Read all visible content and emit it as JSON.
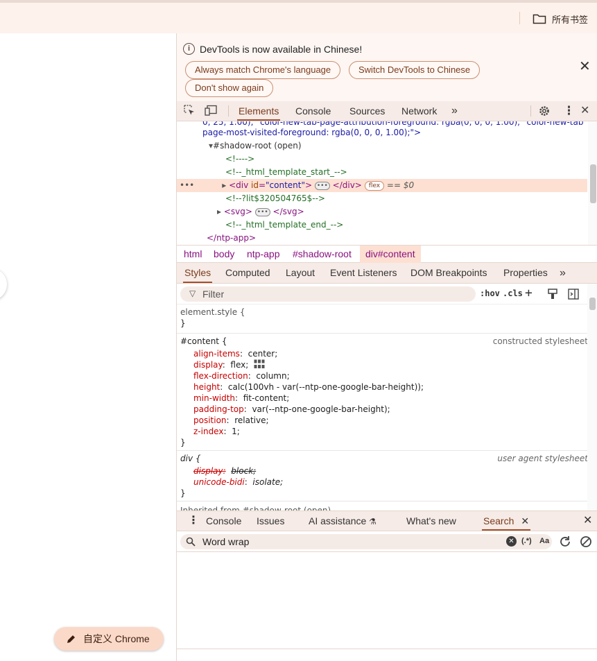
{
  "bookmarks_bar": {
    "all_bookmarks_label": "所有书签",
    "folder_icon": "folder-icon"
  },
  "page": {
    "customize_label": "自定义 Chrome",
    "pencil_icon": "pencil-icon"
  },
  "infobar": {
    "message": "DevTools is now available in Chinese!",
    "buttons": [
      "Always match Chrome's language",
      "Switch DevTools to Chinese",
      "Don't show again"
    ]
  },
  "toolbar": {
    "tabs": [
      "Elements",
      "Console",
      "Sources",
      "Network"
    ],
    "active_tab": "Elements",
    "more": "»"
  },
  "elements_tree": {
    "line0": "0, 25, 1.00);\" color-new-tab-page-attribution-foreground: rgba(0, 0, 0, 1.00);\" color-new-tab",
    "line1_a": "page-most-visited-foreground",
    "line1_b": ": rgba(0, 0, 0, 1.00);\">",
    "shadow_root": "#shadow-root (open)",
    "c1": "<!---->",
    "c2": "<!--_html_template_start_-->",
    "div_open": "<div ",
    "div_attr": "id",
    "div_attr_val": "\"content\"",
    "div_close": "</div>",
    "flex_badge": "flex",
    "eq": "== $0",
    "c3": "<!--?lit$320504765$-->",
    "svg_open": "<svg>",
    "svg_close": "</svg>",
    "c4": "<!--_html_template_end_-->",
    "ntp_close": "</ntp-app>"
  },
  "breadcrumbs": [
    "html",
    "body",
    "ntp-app",
    "#shadow-root",
    "div#content"
  ],
  "styles_tabs": [
    "Styles",
    "Computed",
    "Layout",
    "Event Listeners",
    "DOM Breakpoints",
    "Properties"
  ],
  "filter": {
    "placeholder": "Filter",
    "hov": ":hov",
    "cls": ".cls"
  },
  "rules": {
    "element_style": "element.style {",
    "close": "}",
    "content_selector": "#content {",
    "content_source": "constructed stylesheet",
    "content_props": [
      {
        "name": "align-items",
        "value": "center;"
      },
      {
        "name": "display",
        "value": "flex;"
      },
      {
        "name": "flex-direction",
        "value": "column;"
      },
      {
        "name": "height",
        "value": "calc(100vh - var(--ntp-one-google-bar-height));"
      },
      {
        "name": "min-width",
        "value": "fit-content;"
      },
      {
        "name": "padding-top",
        "value": "var(--ntp-one-google-bar-height);"
      },
      {
        "name": "position",
        "value": "relative;"
      },
      {
        "name": "z-index",
        "value": "1;"
      }
    ],
    "div_selector": "div {",
    "div_source": "user agent stylesheet",
    "div_props": [
      {
        "name": "display",
        "value": "block;"
      },
      {
        "name": "unicode-bidi",
        "value": "isolate;"
      }
    ],
    "inherited": "Inherited from #shadow-root (open)"
  },
  "drawer": {
    "tabs": [
      "Console",
      "Issues",
      "AI assistance",
      "What's new",
      "Search"
    ],
    "active_tab": "Search",
    "search_value": "Word wrap",
    "regex_label": "(.*)",
    "case_label": "Aa"
  }
}
